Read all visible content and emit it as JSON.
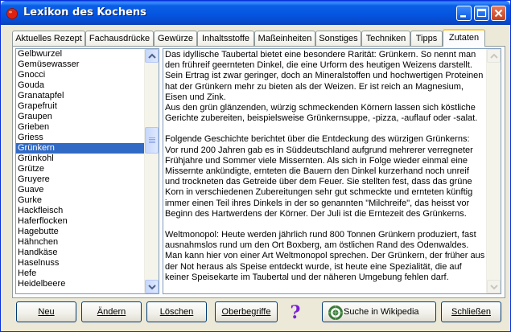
{
  "window": {
    "title": "Lexikon des Kochens",
    "colors": {
      "titlebar": "#0554df",
      "selection": "#316ac5",
      "active_tab_highlight": "#ffc83c"
    }
  },
  "tabs": [
    {
      "label": "Aktuelles Rezept",
      "active": false
    },
    {
      "label": "Fachausdrücke",
      "active": false
    },
    {
      "label": "Gewürze",
      "active": false
    },
    {
      "label": "Inhaltsstoffe",
      "active": false
    },
    {
      "label": "Maßeinheiten",
      "active": false
    },
    {
      "label": "Sonstiges",
      "active": false
    },
    {
      "label": "Techniken",
      "active": false
    },
    {
      "label": "Tipps",
      "active": false
    },
    {
      "label": "Zutaten",
      "active": true
    }
  ],
  "list": {
    "selected": "Grünkern",
    "items": [
      "Gelbwurzel",
      "Gemüsewasser",
      "Gnocci",
      "Gouda",
      "Granatapfel",
      "Grapefruit",
      "Graupen",
      "Grieben",
      "Griess",
      "Grünkern",
      "Grünkohl",
      "Grütze",
      "Gruyere",
      "Guave",
      "Gurke",
      "Hackfleisch",
      "Haferflocken",
      "Hagebutte",
      "Hähnchen",
      "Handkäse",
      "Haselnuss",
      "Hefe",
      "Heidelbeere"
    ]
  },
  "description": {
    "paragraphs": [
      "Das idyllische Taubertal bietet eine besondere Rarität: Grünkern. So nennt man den frühreif geernteten Dinkel, die eine Urform des heutigen Weizens darstellt. Sein Ertrag ist zwar geringer, doch an Mineralstoffen und hochwertigen Proteinen hat der Grünkern mehr zu bieten als der Weizen. Er ist reich an Magnesium, Eisen und Zink.",
      "Aus den grün glänzenden, würzig schmeckenden Körnern lassen sich köstliche Gerichte zubereiten, beispielsweise Grünkernsuppe, -pizza, -auflauf oder -salat.",
      "",
      "Folgende Geschichte berichtet über die Entdeckung des würzigen Grünkerns: Vor rund 200 Jahren gab es in Süddeutschland aufgrund mehrerer verregneter Frühjahre und Sommer viele Missernten. Als sich in Folge wieder einmal eine Missernte ankündigte, ernteten die Bauern den Dinkel kurzerhand noch unreif und trockneten das Getreide über dem Feuer. Sie stellten fest, dass das grüne Korn in verschiedenen Zubereitungen sehr gut schmeckte und ernteten künftig immer einen Teil ihres Dinkels in der so genannten \"Milchreife\", das heisst vor Beginn des Hartwerdens der Körner. Der Juli ist die Erntezeit des Grünkerns.",
      "",
      "Weltmonopol: Heute werden jährlich rund 800 Tonnen Grünkern produziert, fast ausnahmslos rund um den Ort Boxberg, am östlichen Rand des Odenwaldes. Man kann hier von einer Art Weltmonopol sprechen. Der Grünkern, der früher aus der Not heraus als Speise entdeckt wurde, ist heute eine Spezialität, die auf keiner Speisekarte im Taubertal und der näheren Umgebung fehlen darf."
    ]
  },
  "buttons": {
    "new": "Neu",
    "edit": "Ändern",
    "delete": "Löschen",
    "categories": "Oberbegriffe",
    "help_icon": "question-mark-icon",
    "wikipedia": "Suche in Wikipedia",
    "close": "Schließen"
  }
}
